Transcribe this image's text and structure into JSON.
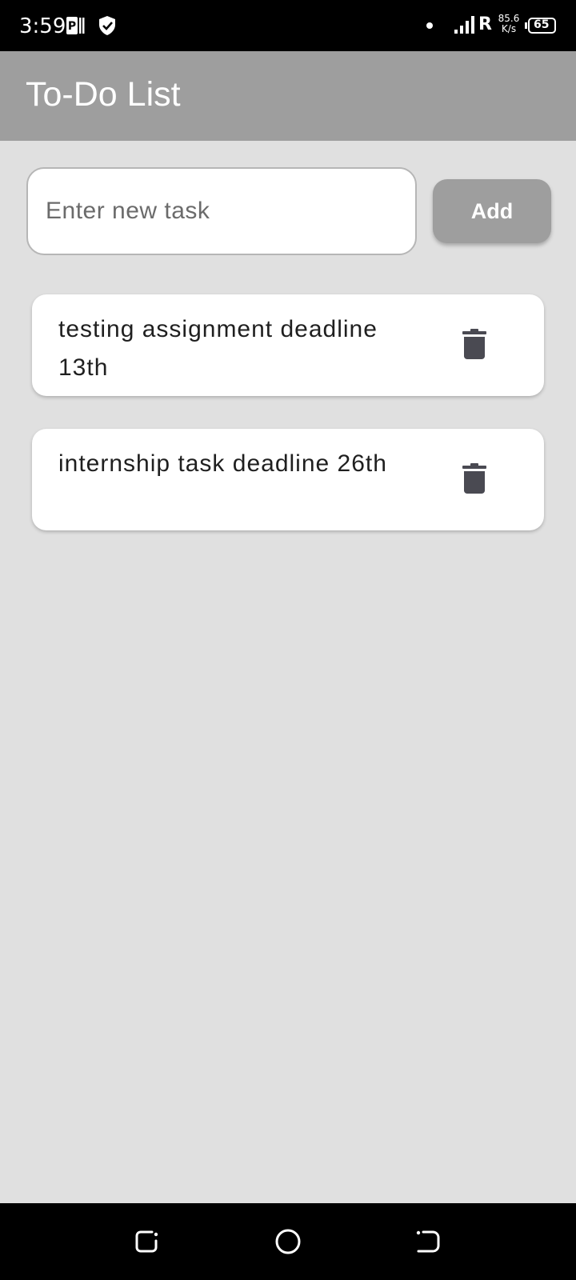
{
  "status_bar": {
    "time": "3:59",
    "network_type": "R",
    "speed_value": "85.6",
    "speed_unit": "K/s",
    "battery": "65",
    "icons": [
      "parking-icon",
      "shield-check-icon",
      "notification-dot-icon",
      "signal-icon",
      "battery-icon"
    ]
  },
  "app_bar": {
    "title": "To-Do List",
    "color": "#9e9e9e"
  },
  "new_task": {
    "placeholder": "Enter new task",
    "value": "",
    "add_label": "Add"
  },
  "tasks": [
    {
      "text": "testing assignment deadline 13th",
      "icon": "trash-icon"
    },
    {
      "text": "internship task deadline 26th",
      "icon": "trash-icon"
    }
  ],
  "nav_bar": {
    "icons": [
      "recent-apps-icon",
      "home-icon",
      "back-icon"
    ]
  },
  "colors": {
    "background": "#e0e0e0",
    "card": "#ffffff",
    "accent": "#9e9e9e",
    "icon": "#4a4a52"
  }
}
